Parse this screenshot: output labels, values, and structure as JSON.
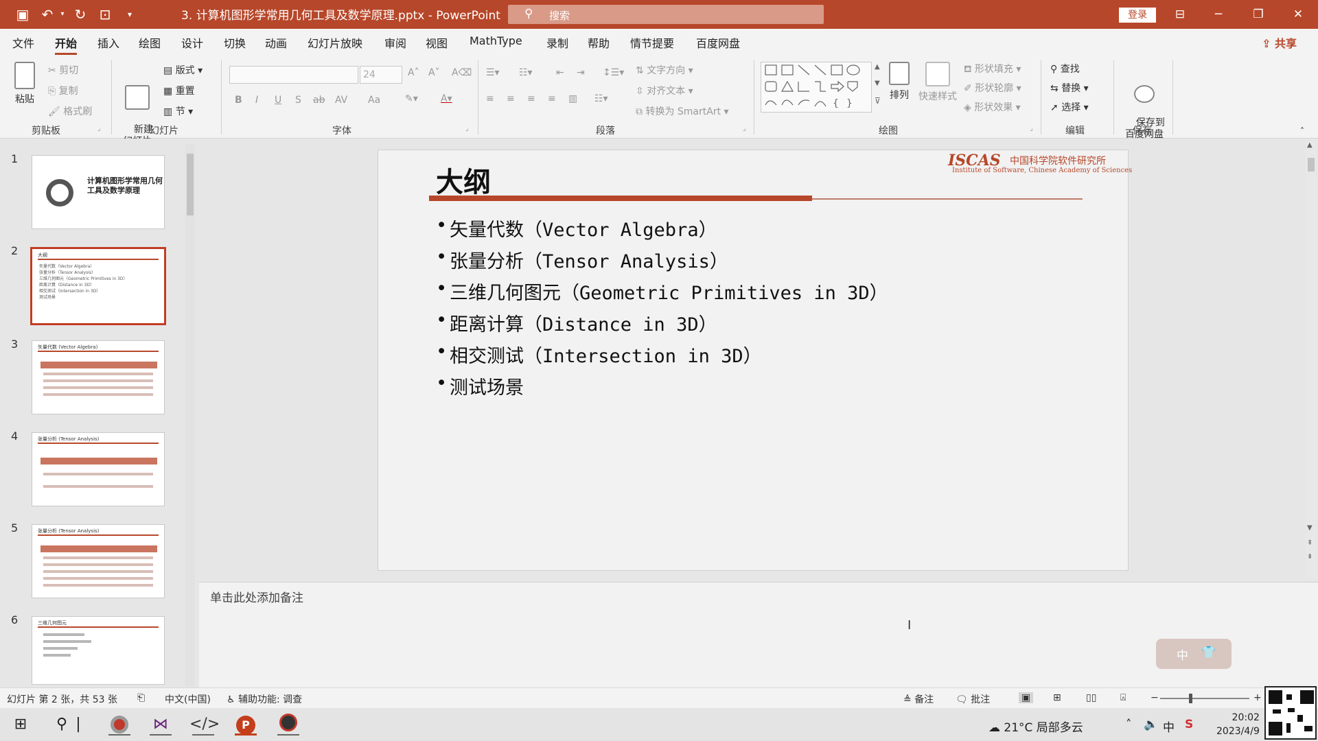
{
  "app": {
    "doc_title": "3. 计算机图形学常用几何工具及数学原理.pptx  -  PowerPoint",
    "search_placeholder": "搜索",
    "login_label": "登录",
    "share_label": "共享",
    "accent_color": "#b7472a"
  },
  "menu": {
    "tabs": [
      "文件",
      "开始",
      "插入",
      "绘图",
      "设计",
      "切换",
      "动画",
      "幻灯片放映",
      "审阅",
      "视图",
      "MathType",
      "录制",
      "帮助",
      "情节提要",
      "百度网盘"
    ],
    "active": "开始"
  },
  "ribbon": {
    "clipboard": {
      "paste": "粘贴",
      "cut": "剪切",
      "copy": "复制",
      "format_painter": "格式刷",
      "label": "剪贴板"
    },
    "slides": {
      "new_slide": "新建\n幻灯片",
      "layout": "版式",
      "reset": "重置",
      "section": "节",
      "label": "幻灯片"
    },
    "font": {
      "size": "24",
      "label": "字体",
      "buttons": [
        "B",
        "I",
        "U",
        "S",
        "ab",
        "AV",
        "Aa"
      ]
    },
    "paragraph": {
      "text_direction": "文字方向",
      "align_text": "对齐文本",
      "smartart": "转换为 SmartArt",
      "label": "段落"
    },
    "drawing": {
      "arrange": "排列",
      "quick_styles": "快速样式",
      "shape_fill": "形状填充",
      "shape_outline": "形状轮廓",
      "shape_effects": "形状效果",
      "label": "绘图"
    },
    "editing": {
      "find": "查找",
      "replace": "替换",
      "select": "选择",
      "label": "编辑"
    },
    "save": {
      "save_to_baidu": "保存到\n百度网盘",
      "label": "保存"
    }
  },
  "thumbnails": [
    {
      "num": "1",
      "title": "计算机图形学常用几何\n工具及数学原理"
    },
    {
      "num": "2",
      "title": "大纲",
      "selected": true
    },
    {
      "num": "3",
      "title": "矢量代数 (Vector Algebra)"
    },
    {
      "num": "4",
      "title": "张量分析 (Tensor Analysis)"
    },
    {
      "num": "5",
      "title": "张量分析 (Tensor Analysis)"
    },
    {
      "num": "6",
      "title": "三维几何图元"
    }
  ],
  "slide": {
    "title": "大纲",
    "logo_mark": "ISCAS",
    "logo_cn": "中国科学院软件研究所",
    "logo_en": "Institute of Software, Chinese Academy of Sciences",
    "bullets": [
      "矢量代数（Vector Algebra）",
      "张量分析（Tensor Analysis）",
      "三维几何图元（Geometric Primitives in 3D）",
      "距离计算（Distance in 3D）",
      "相交测试（Intersection in 3D）",
      "测试场景"
    ]
  },
  "notes": {
    "placeholder": "单击此处添加备注",
    "ime_zh": "中"
  },
  "status": {
    "slide_position": "幻灯片 第 2 张，共 53 张",
    "language": "中文(中国)",
    "accessibility": "辅助功能: 调查",
    "notes_btn": "备注",
    "comments_btn": "批注"
  },
  "taskbar": {
    "weather": "21°C  局部多云",
    "time": "20:02",
    "date": "2023/4/9",
    "ime_tray": "中"
  }
}
